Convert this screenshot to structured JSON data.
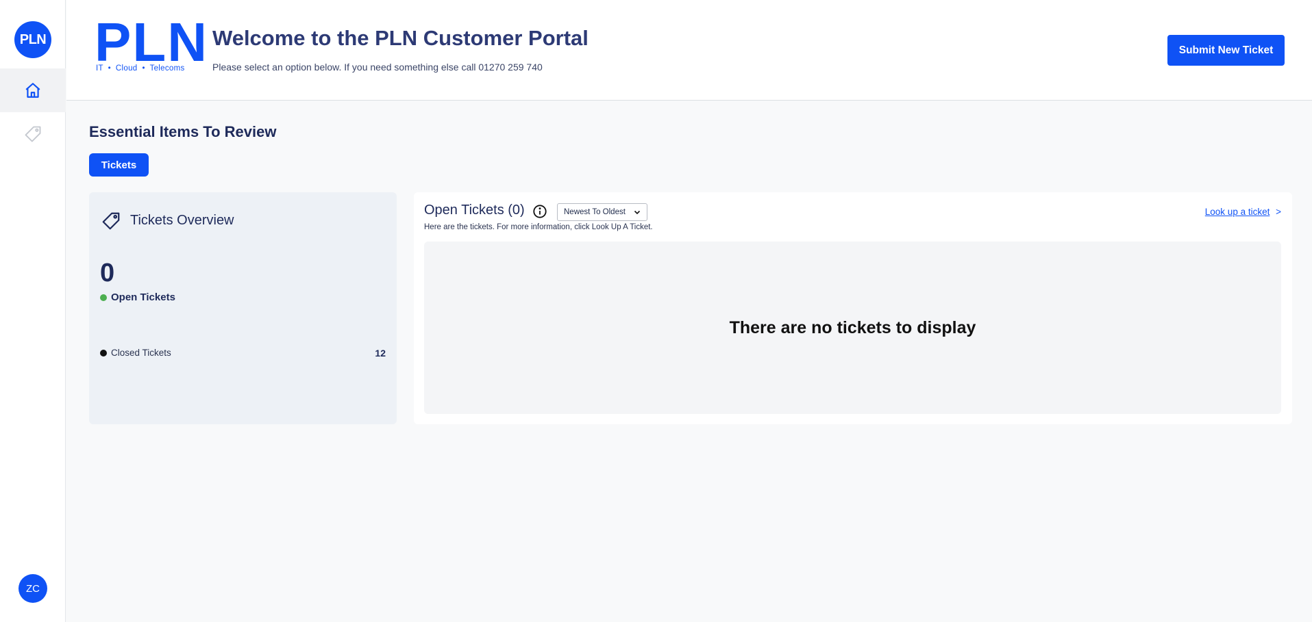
{
  "sidebar": {
    "logo_text": "PLN",
    "items": [
      {
        "name": "home",
        "icon": "home-icon",
        "active": true
      },
      {
        "name": "tickets",
        "icon": "tag-icon",
        "active": false
      }
    ],
    "avatar_initials": "ZC"
  },
  "header": {
    "brand_logo": "PLN",
    "brand_tagline": "IT  •  Cloud  •  Telecoms",
    "title": "Welcome to the PLN Customer Portal",
    "subtitle": "Please select an option below. If you need something else call 01270 259 740",
    "submit_button_label": "Submit New Ticket"
  },
  "section": {
    "title": "Essential Items To Review",
    "tabs": [
      {
        "label": "Tickets",
        "active": true
      }
    ]
  },
  "overview": {
    "title": "Tickets Overview",
    "open_count": "0",
    "open_label": "Open Tickets",
    "closed_label": "Closed Tickets",
    "closed_count": "12"
  },
  "open_tickets": {
    "title": "Open Tickets (0)",
    "sort_selected": "Newest To Oldest",
    "description": "Here are the tickets. For more information, click Look Up A Ticket.",
    "lookup_link": "Look up a ticket",
    "lookup_arrow": ">",
    "empty_message": "There are no tickets to display"
  },
  "colors": {
    "accent": "#0f52f5",
    "heading": "#1e2a5a",
    "open_dot": "#4caf50",
    "closed_dot": "#111111"
  }
}
